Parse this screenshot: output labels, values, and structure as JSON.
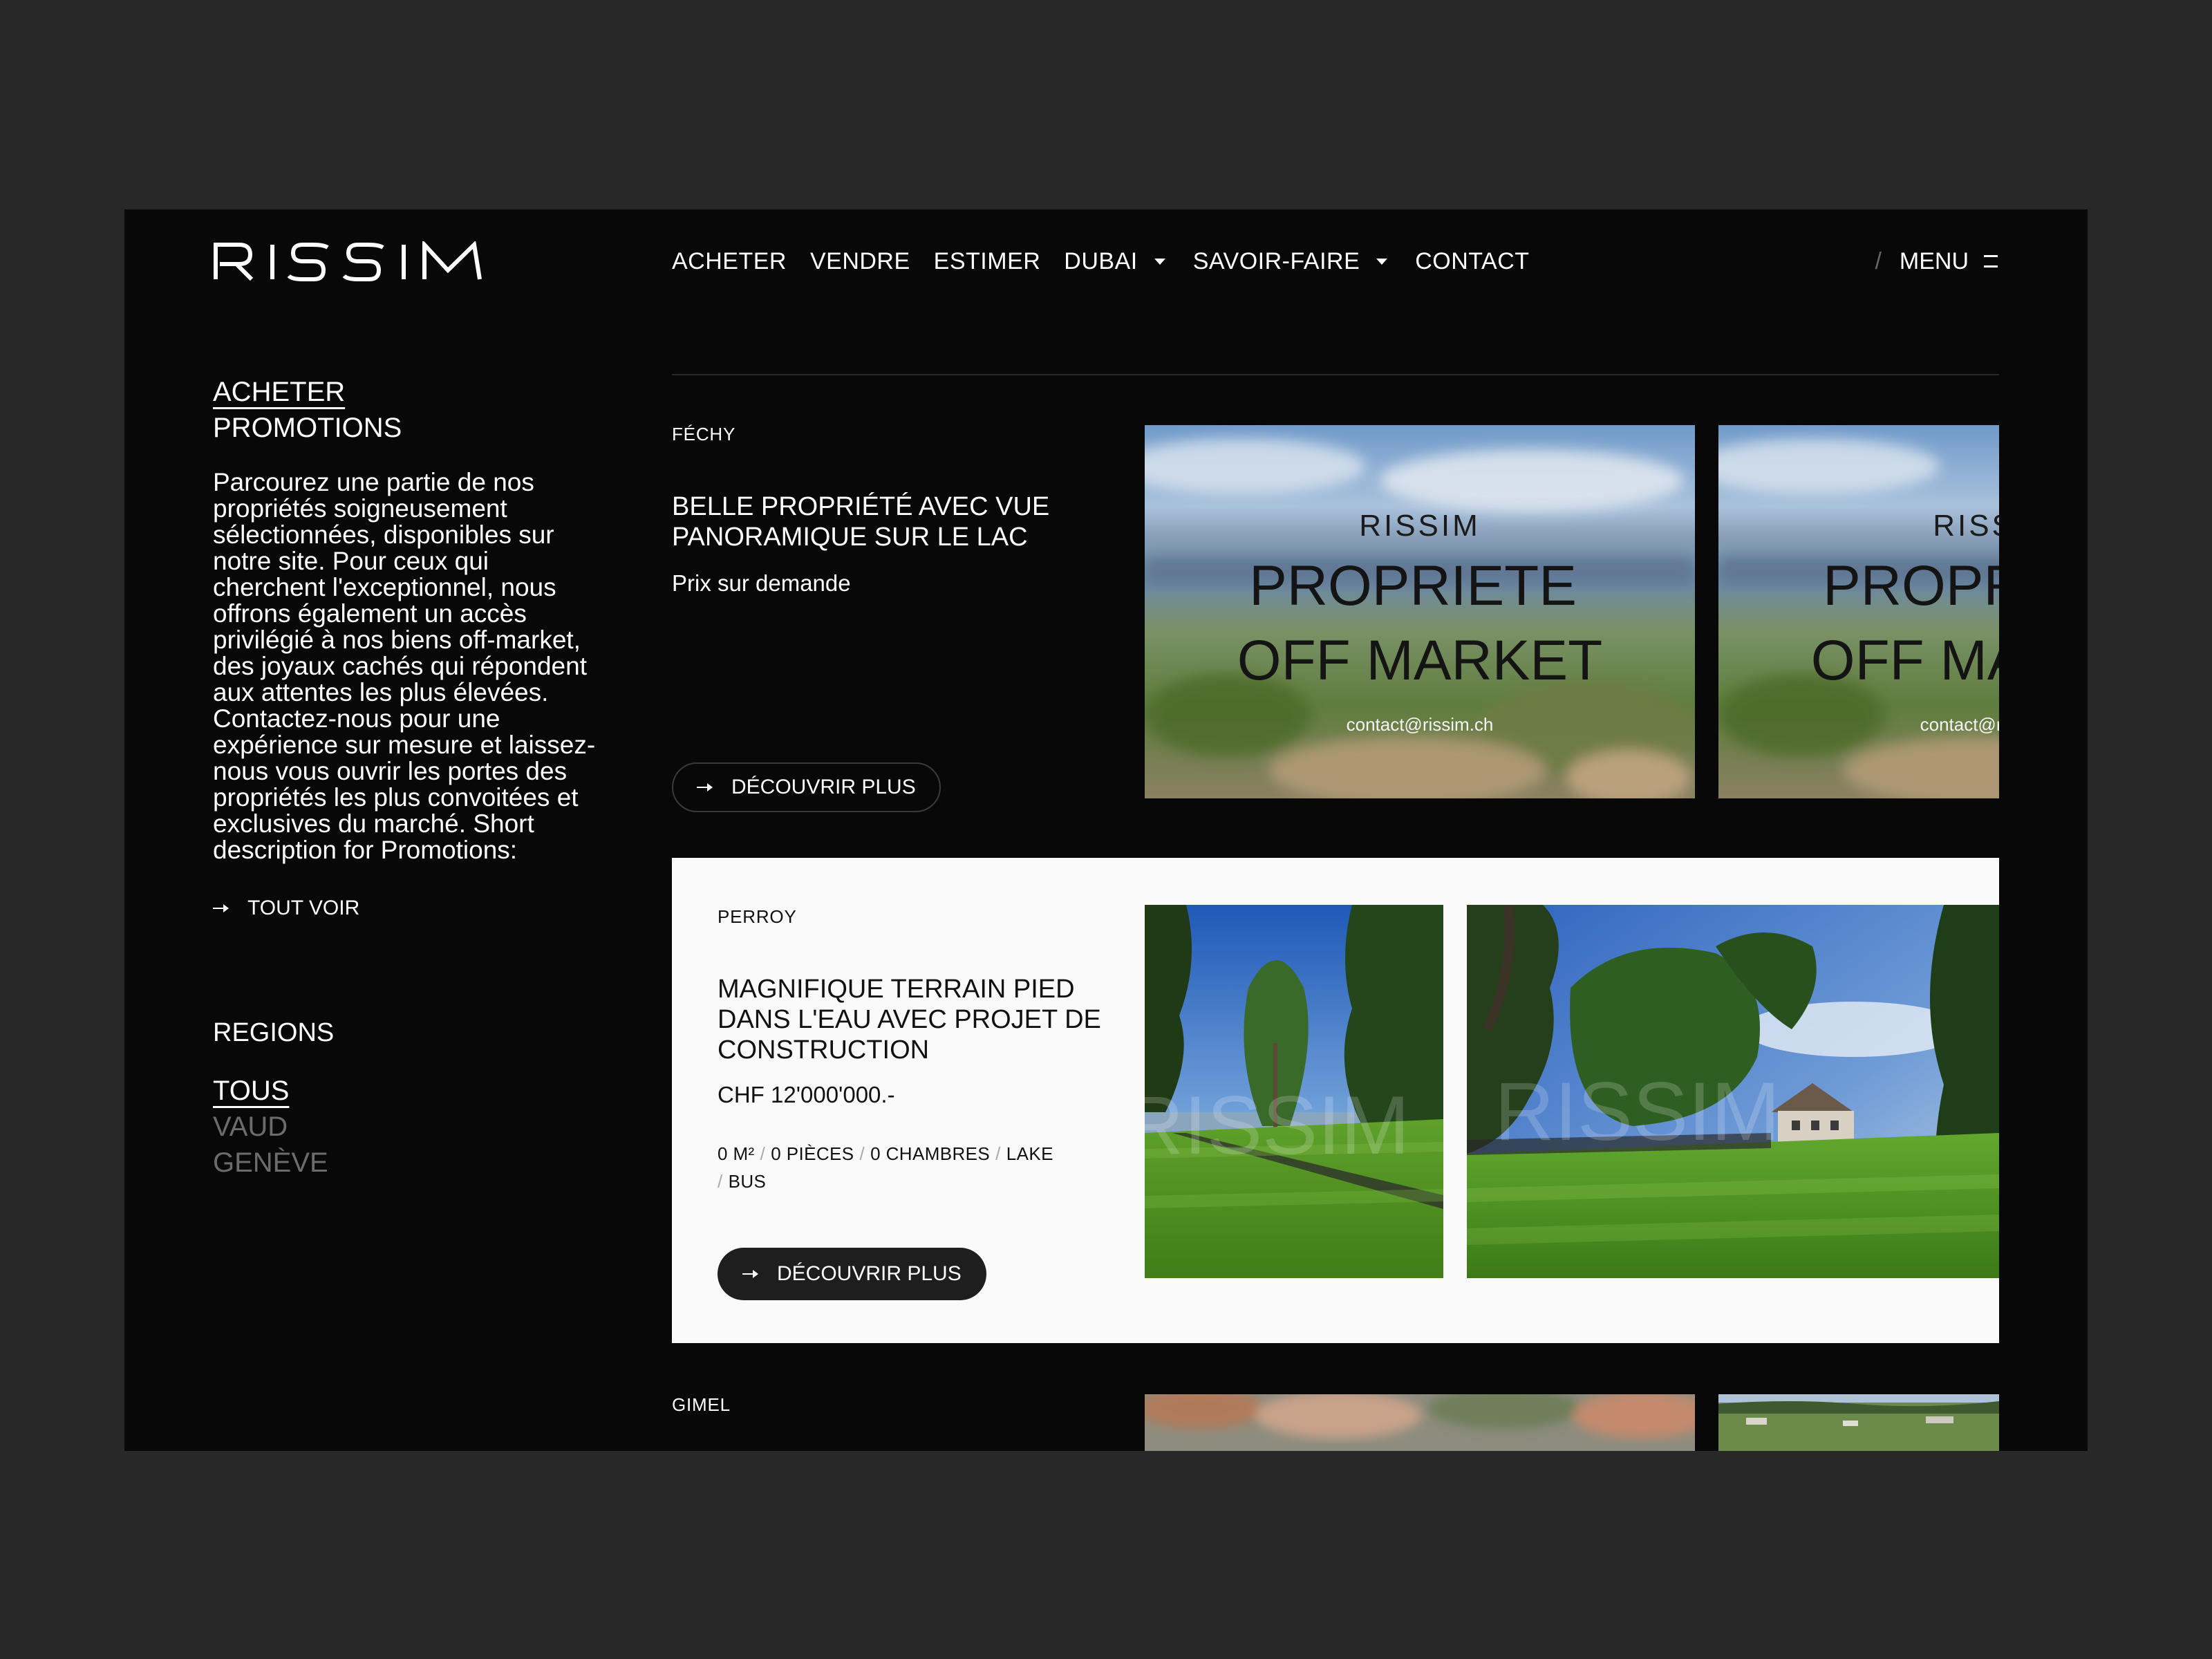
{
  "brand": {
    "logo": "RISSIM"
  },
  "nav": {
    "items": [
      {
        "label": "ACHETER"
      },
      {
        "label": "VENDRE"
      },
      {
        "label": "ESTIMER"
      },
      {
        "label": "DUBAI",
        "has_dropdown": true
      },
      {
        "label": "SAVOIR-FAIRE",
        "has_dropdown": true
      },
      {
        "label": "CONTACT"
      }
    ],
    "menu_separator": "/",
    "menu_label": "MENU"
  },
  "sidebar": {
    "breadcrumb": [
      "ACHETER",
      "PROMOTIONS"
    ],
    "description": "Parcourez une partie de nos propriétés soigneusement sélectionnées, disponibles sur notre site. Pour ceux qui cherchent l'exceptionnel, nous offrons également un accès privilégié à nos biens off-market, des joyaux cachés qui répondent aux attentes les plus élevées. Contactez-nous pour une expérience sur mesure et laissez-nous vous ouvrir les portes des propriétés les plus convoitées et exclusives du marché. Short description for Promotions:",
    "see_all": "TOUT VOIR",
    "regions_title": "REGIONS",
    "regions": [
      "TOUS",
      "VAUD",
      "GENÈVE"
    ],
    "active_region": "TOUS"
  },
  "listings": [
    {
      "location": "FÉCHY",
      "title": "BELLE PROPRIÉTÉ AVEC VUE PANORAMIQUE SUR LE LAC",
      "price": "Prix sur demande",
      "cta": "DÉCOUVRIR PLUS",
      "placeholder": {
        "brand": "RISSIM",
        "line1": "PROPRIETE",
        "line2": "OFF MARKET",
        "email": "contact@rissim.ch"
      }
    },
    {
      "location": "PERROY",
      "title": "MAGNIFIQUE TERRAIN PIED DANS L'EAU AVEC PROJET DE CONSTRUCTION",
      "price": "CHF 12'000'000.-",
      "specs": [
        "0 M²",
        "0 PIÈCES",
        "0 CHAMBRES",
        "LAKE",
        "BUS"
      ],
      "specs_separator": "/",
      "cta": "DÉCOUVRIR PLUS",
      "watermark": "RISSIM"
    },
    {
      "location": "GIMEL"
    }
  ],
  "colors": {
    "page_bg": "#282828",
    "screen_bg": "#080808",
    "highlight_card_bg": "#fafafa",
    "muted_region": "#6c6c6c"
  }
}
